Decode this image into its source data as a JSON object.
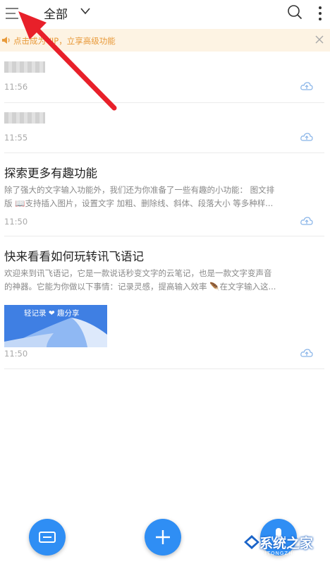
{
  "header": {
    "title": "全部"
  },
  "banner": {
    "text": "点击成为VIP，立享高级功能",
    "color": "#e89a3a",
    "background": "#fdf3e3"
  },
  "notes": [
    {
      "time": "11:56"
    },
    {
      "time": "11:55"
    },
    {
      "title": "探索更多有趣功能",
      "snippet_line1": "除了强大的文字输入功能外，我们还为你准备了一些有趣的小功能： 图文排",
      "snippet_line2": "版 📖支持插入图片，设置文字 加粗、删除线、斜体、段落大小 等多种样...",
      "time": "11:50"
    },
    {
      "title": "快来看看如何玩转讯飞语记",
      "snippet_line1": "欢迎来到讯飞语记，它是一款说话秒变文字的云笔记，也是一款文字变声音",
      "snippet_line2": "的神器。它能为你做以下事情：记录灵感，提高输入效率 🪶在文字输入这...",
      "thumbnail_caption": "轻记录 ❤ 趣分享",
      "time": "11:50"
    }
  ],
  "watermark": {
    "text": "系统之家",
    "sub": "XITONGZHIJIA.NET"
  },
  "colors": {
    "accent": "#2f8ef4",
    "arrow": "#e8202a"
  }
}
